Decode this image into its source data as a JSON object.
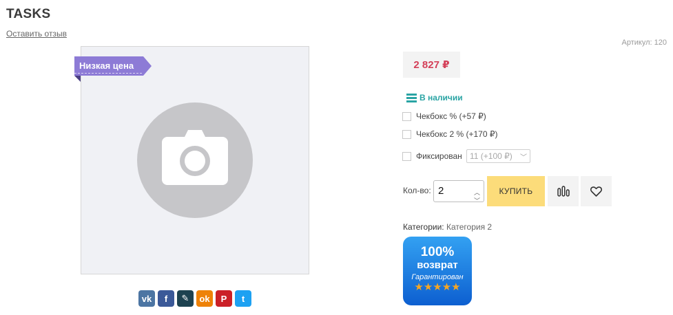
{
  "product": {
    "title": "TASKS",
    "review_link": "Оставить отзыв",
    "sku": "Артикул: 120",
    "ribbon": "Низкая цена",
    "price": "2 827 ₽",
    "stock": "В наличии"
  },
  "options": [
    {
      "label": "Чекбокс % (+57 ₽)"
    },
    {
      "label": "Чекбокс 2 % (+170 ₽)"
    },
    {
      "label": "Фиксирован",
      "select_value": "11 (+100 ₽)"
    }
  ],
  "purchase": {
    "qty_label": "Кол-во:",
    "qty_value": "2",
    "buy_label": "КУПИТЬ"
  },
  "categories": {
    "label": "Категории:",
    "value": "Категория 2"
  },
  "guarantee_badge": {
    "line1": "100%",
    "line2": "возврат",
    "line3": "Гарантирован",
    "stars": "★★★★★"
  },
  "social": [
    {
      "icon": "vk-icon",
      "glyph": "vk",
      "color": "#4c75a3"
    },
    {
      "icon": "facebook-icon",
      "glyph": "f",
      "color": "#3b5998"
    },
    {
      "icon": "livejournal-icon",
      "glyph": "✎",
      "color": "#1d4250"
    },
    {
      "icon": "odnoklassniki-icon",
      "glyph": "ok",
      "color": "#ee8208"
    },
    {
      "icon": "pinterest-icon",
      "glyph": "P",
      "color": "#cb2027"
    },
    {
      "icon": "twitter-icon",
      "glyph": "t",
      "color": "#1da1f2"
    }
  ],
  "colors": {
    "price": "#d43f58",
    "ribbon": "#8d7bd6",
    "stock": "#2aa4a4",
    "buy_button": "#fcdc7a"
  }
}
